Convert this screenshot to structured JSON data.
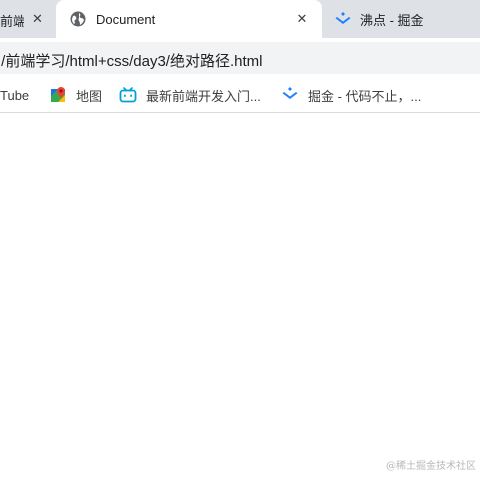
{
  "tabs": [
    {
      "title": "前端",
      "active": false,
      "icon": "page-icon"
    },
    {
      "title": "Document",
      "active": true,
      "icon": "globe-icon"
    },
    {
      "title": "沸点 - 掘金",
      "active": false,
      "icon": "juejin-icon"
    }
  ],
  "address_bar": {
    "url": ":/前端学习/html+css/day3/绝对路径.html"
  },
  "bookmarks": [
    {
      "label": "Tube",
      "icon": "youtube-icon"
    },
    {
      "label": "地图",
      "icon": "maps-icon"
    },
    {
      "label": "最新前端开发入门...",
      "icon": "bilibili-icon"
    },
    {
      "label": "掘金 - 代码不止，...",
      "icon": "juejin-icon"
    }
  ],
  "watermark": "@稀土掘金技术社区",
  "colors": {
    "tab_strip": "#dee1e6",
    "active_tab": "#ffffff",
    "omnibox": "#f1f3f4",
    "juejin_blue": "#1e80ff"
  }
}
